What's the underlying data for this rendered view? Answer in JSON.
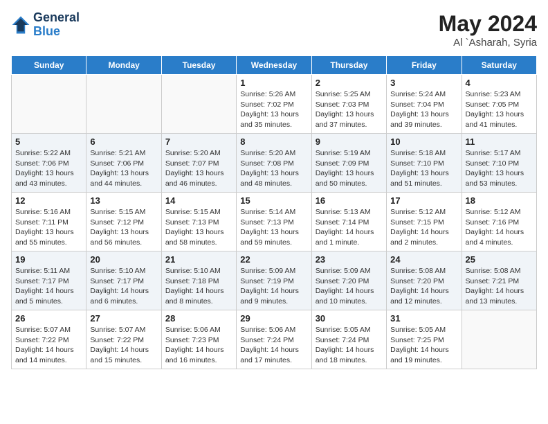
{
  "header": {
    "logo_line1": "General",
    "logo_line2": "Blue",
    "month_year": "May 2024",
    "location": "Al `Asharah, Syria"
  },
  "weekdays": [
    "Sunday",
    "Monday",
    "Tuesday",
    "Wednesday",
    "Thursday",
    "Friday",
    "Saturday"
  ],
  "weeks": [
    [
      {
        "day": "",
        "info": ""
      },
      {
        "day": "",
        "info": ""
      },
      {
        "day": "",
        "info": ""
      },
      {
        "day": "1",
        "info": "Sunrise: 5:26 AM\nSunset: 7:02 PM\nDaylight: 13 hours\nand 35 minutes."
      },
      {
        "day": "2",
        "info": "Sunrise: 5:25 AM\nSunset: 7:03 PM\nDaylight: 13 hours\nand 37 minutes."
      },
      {
        "day": "3",
        "info": "Sunrise: 5:24 AM\nSunset: 7:04 PM\nDaylight: 13 hours\nand 39 minutes."
      },
      {
        "day": "4",
        "info": "Sunrise: 5:23 AM\nSunset: 7:05 PM\nDaylight: 13 hours\nand 41 minutes."
      }
    ],
    [
      {
        "day": "5",
        "info": "Sunrise: 5:22 AM\nSunset: 7:06 PM\nDaylight: 13 hours\nand 43 minutes."
      },
      {
        "day": "6",
        "info": "Sunrise: 5:21 AM\nSunset: 7:06 PM\nDaylight: 13 hours\nand 44 minutes."
      },
      {
        "day": "7",
        "info": "Sunrise: 5:20 AM\nSunset: 7:07 PM\nDaylight: 13 hours\nand 46 minutes."
      },
      {
        "day": "8",
        "info": "Sunrise: 5:20 AM\nSunset: 7:08 PM\nDaylight: 13 hours\nand 48 minutes."
      },
      {
        "day": "9",
        "info": "Sunrise: 5:19 AM\nSunset: 7:09 PM\nDaylight: 13 hours\nand 50 minutes."
      },
      {
        "day": "10",
        "info": "Sunrise: 5:18 AM\nSunset: 7:10 PM\nDaylight: 13 hours\nand 51 minutes."
      },
      {
        "day": "11",
        "info": "Sunrise: 5:17 AM\nSunset: 7:10 PM\nDaylight: 13 hours\nand 53 minutes."
      }
    ],
    [
      {
        "day": "12",
        "info": "Sunrise: 5:16 AM\nSunset: 7:11 PM\nDaylight: 13 hours\nand 55 minutes."
      },
      {
        "day": "13",
        "info": "Sunrise: 5:15 AM\nSunset: 7:12 PM\nDaylight: 13 hours\nand 56 minutes."
      },
      {
        "day": "14",
        "info": "Sunrise: 5:15 AM\nSunset: 7:13 PM\nDaylight: 13 hours\nand 58 minutes."
      },
      {
        "day": "15",
        "info": "Sunrise: 5:14 AM\nSunset: 7:13 PM\nDaylight: 13 hours\nand 59 minutes."
      },
      {
        "day": "16",
        "info": "Sunrise: 5:13 AM\nSunset: 7:14 PM\nDaylight: 14 hours\nand 1 minute."
      },
      {
        "day": "17",
        "info": "Sunrise: 5:12 AM\nSunset: 7:15 PM\nDaylight: 14 hours\nand 2 minutes."
      },
      {
        "day": "18",
        "info": "Sunrise: 5:12 AM\nSunset: 7:16 PM\nDaylight: 14 hours\nand 4 minutes."
      }
    ],
    [
      {
        "day": "19",
        "info": "Sunrise: 5:11 AM\nSunset: 7:17 PM\nDaylight: 14 hours\nand 5 minutes."
      },
      {
        "day": "20",
        "info": "Sunrise: 5:10 AM\nSunset: 7:17 PM\nDaylight: 14 hours\nand 6 minutes."
      },
      {
        "day": "21",
        "info": "Sunrise: 5:10 AM\nSunset: 7:18 PM\nDaylight: 14 hours\nand 8 minutes."
      },
      {
        "day": "22",
        "info": "Sunrise: 5:09 AM\nSunset: 7:19 PM\nDaylight: 14 hours\nand 9 minutes."
      },
      {
        "day": "23",
        "info": "Sunrise: 5:09 AM\nSunset: 7:20 PM\nDaylight: 14 hours\nand 10 minutes."
      },
      {
        "day": "24",
        "info": "Sunrise: 5:08 AM\nSunset: 7:20 PM\nDaylight: 14 hours\nand 12 minutes."
      },
      {
        "day": "25",
        "info": "Sunrise: 5:08 AM\nSunset: 7:21 PM\nDaylight: 14 hours\nand 13 minutes."
      }
    ],
    [
      {
        "day": "26",
        "info": "Sunrise: 5:07 AM\nSunset: 7:22 PM\nDaylight: 14 hours\nand 14 minutes."
      },
      {
        "day": "27",
        "info": "Sunrise: 5:07 AM\nSunset: 7:22 PM\nDaylight: 14 hours\nand 15 minutes."
      },
      {
        "day": "28",
        "info": "Sunrise: 5:06 AM\nSunset: 7:23 PM\nDaylight: 14 hours\nand 16 minutes."
      },
      {
        "day": "29",
        "info": "Sunrise: 5:06 AM\nSunset: 7:24 PM\nDaylight: 14 hours\nand 17 minutes."
      },
      {
        "day": "30",
        "info": "Sunrise: 5:05 AM\nSunset: 7:24 PM\nDaylight: 14 hours\nand 18 minutes."
      },
      {
        "day": "31",
        "info": "Sunrise: 5:05 AM\nSunset: 7:25 PM\nDaylight: 14 hours\nand 19 minutes."
      },
      {
        "day": "",
        "info": ""
      }
    ]
  ]
}
